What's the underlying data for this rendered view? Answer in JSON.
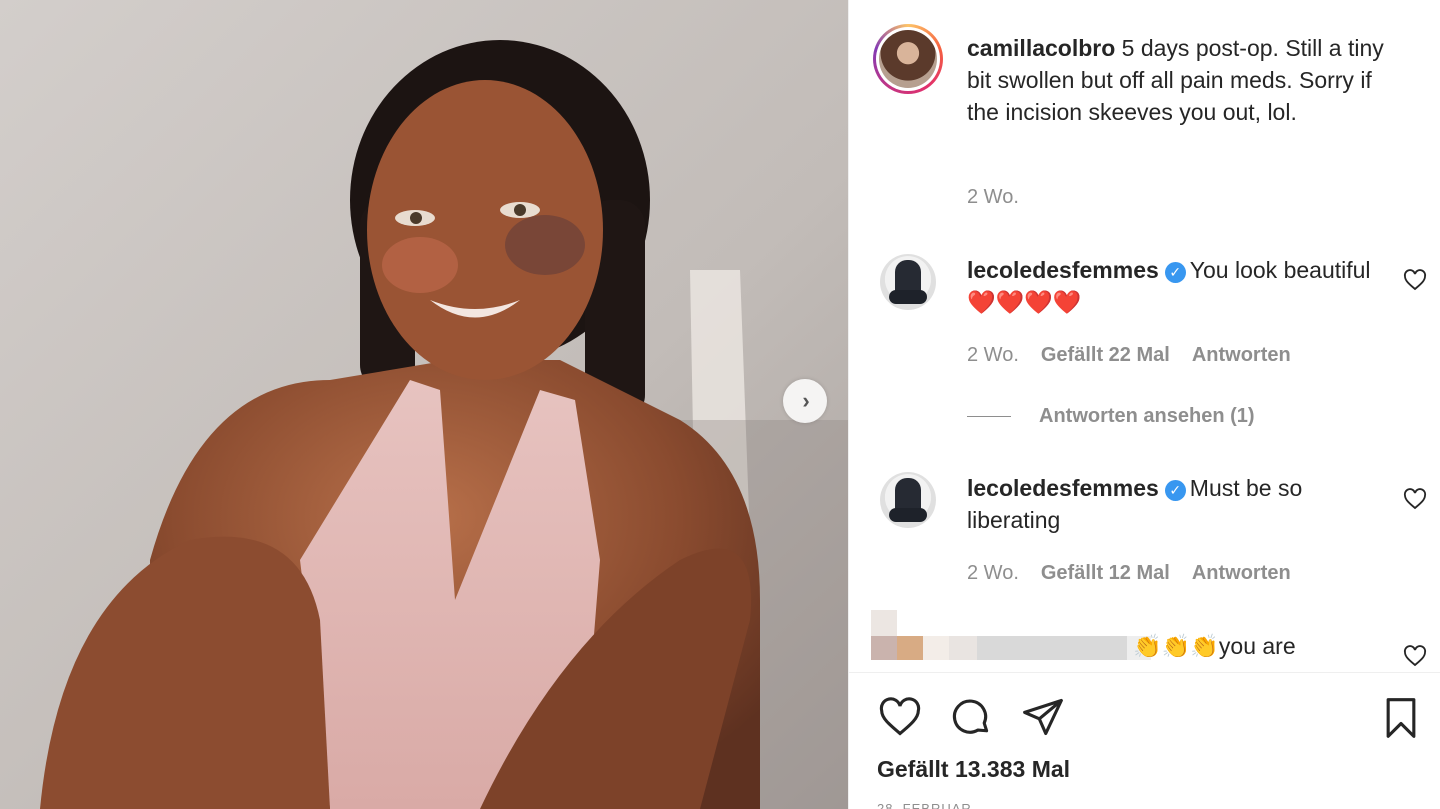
{
  "post": {
    "caption": {
      "username": "camillacolbro",
      "text": "5 days post-op. Still a tiny bit swollen but off all pain meds. Sorry if the incision skeeves you out, lol.",
      "time": "2 Wo."
    },
    "comments": [
      {
        "username": "lecoledesfemmes",
        "verified": true,
        "text": "You look beautiful ❤️❤️❤️❤️",
        "time": "2 Wo.",
        "likes": "Gefällt 22 Mal",
        "reply_label": "Antworten",
        "view_replies": "Antworten ansehen (1)"
      },
      {
        "username": "lecoledesfemmes",
        "verified": true,
        "text": "Must be so liberating",
        "time": "2 Wo.",
        "likes": "Gefällt 12 Mal",
        "reply_label": "Antworten"
      },
      {
        "text": "👏👏👏you are"
      }
    ],
    "likes_total": "Gefällt 13.383 Mal",
    "date": "28. FEBRUAR"
  },
  "icons": {
    "next": "chevron-right-icon",
    "like": "heart-icon",
    "comment": "comment-icon",
    "share": "paper-plane-icon",
    "save": "bookmark-icon"
  },
  "colors": {
    "text": "#262626",
    "muted": "#8e8e8e",
    "verified": "#3897f0",
    "heart": "#ed4956"
  }
}
